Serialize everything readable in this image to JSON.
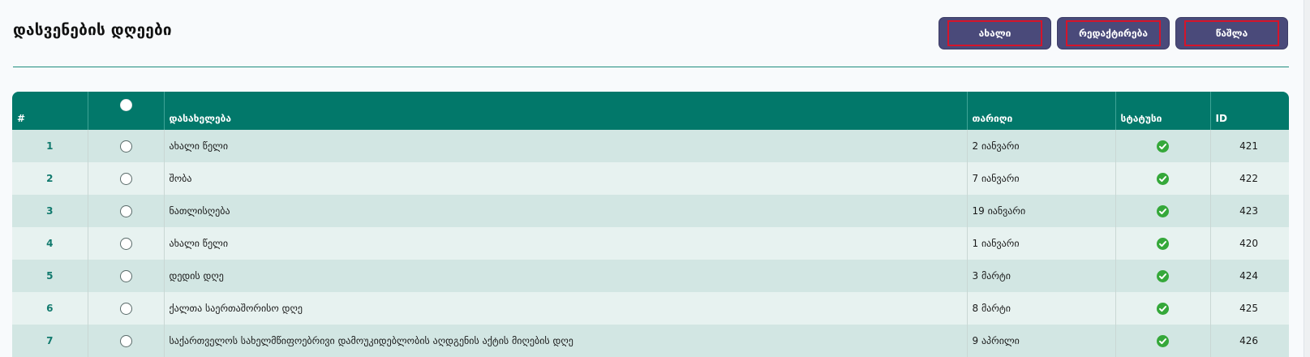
{
  "page": {
    "title": "დასვენების დღეები"
  },
  "toolbar": {
    "new_label": "ახალი",
    "edit_label": "რედაქტირება",
    "delete_label": "წაშლა"
  },
  "table": {
    "headers": {
      "num": "#",
      "name": "დასახელება",
      "date": "თარიღი",
      "status": "სტატუსი",
      "id": "ID"
    },
    "rows": [
      {
        "num": "1",
        "name": "ახალი წელი",
        "date": "2 იანვარი",
        "status": "active",
        "id": "421"
      },
      {
        "num": "2",
        "name": "შობა",
        "date": "7 იანვარი",
        "status": "active",
        "id": "422"
      },
      {
        "num": "3",
        "name": "ნათლისღება",
        "date": "19 იანვარი",
        "status": "active",
        "id": "423"
      },
      {
        "num": "4",
        "name": "ახალი წელი",
        "date": "1 იანვარი",
        "status": "active",
        "id": "420"
      },
      {
        "num": "5",
        "name": "დედის დღე",
        "date": "3 მარტი",
        "status": "active",
        "id": "424"
      },
      {
        "num": "6",
        "name": "ქალთა საერთაშორისო დღე",
        "date": "8 მარტი",
        "status": "active",
        "id": "425"
      },
      {
        "num": "7",
        "name": "საქართველოს სახელმწიფოებრივი დამოუკიდებლობის აღდგენის აქტის მიღების დღე",
        "date": "9 აპრილი",
        "status": "active",
        "id": "426"
      }
    ]
  },
  "colors": {
    "header_bg": "#02786a",
    "button_bg": "#4a4a7a",
    "status_ok": "#35a83a"
  },
  "icons": {
    "status": "check-circle-icon",
    "select": "radio-icon"
  }
}
